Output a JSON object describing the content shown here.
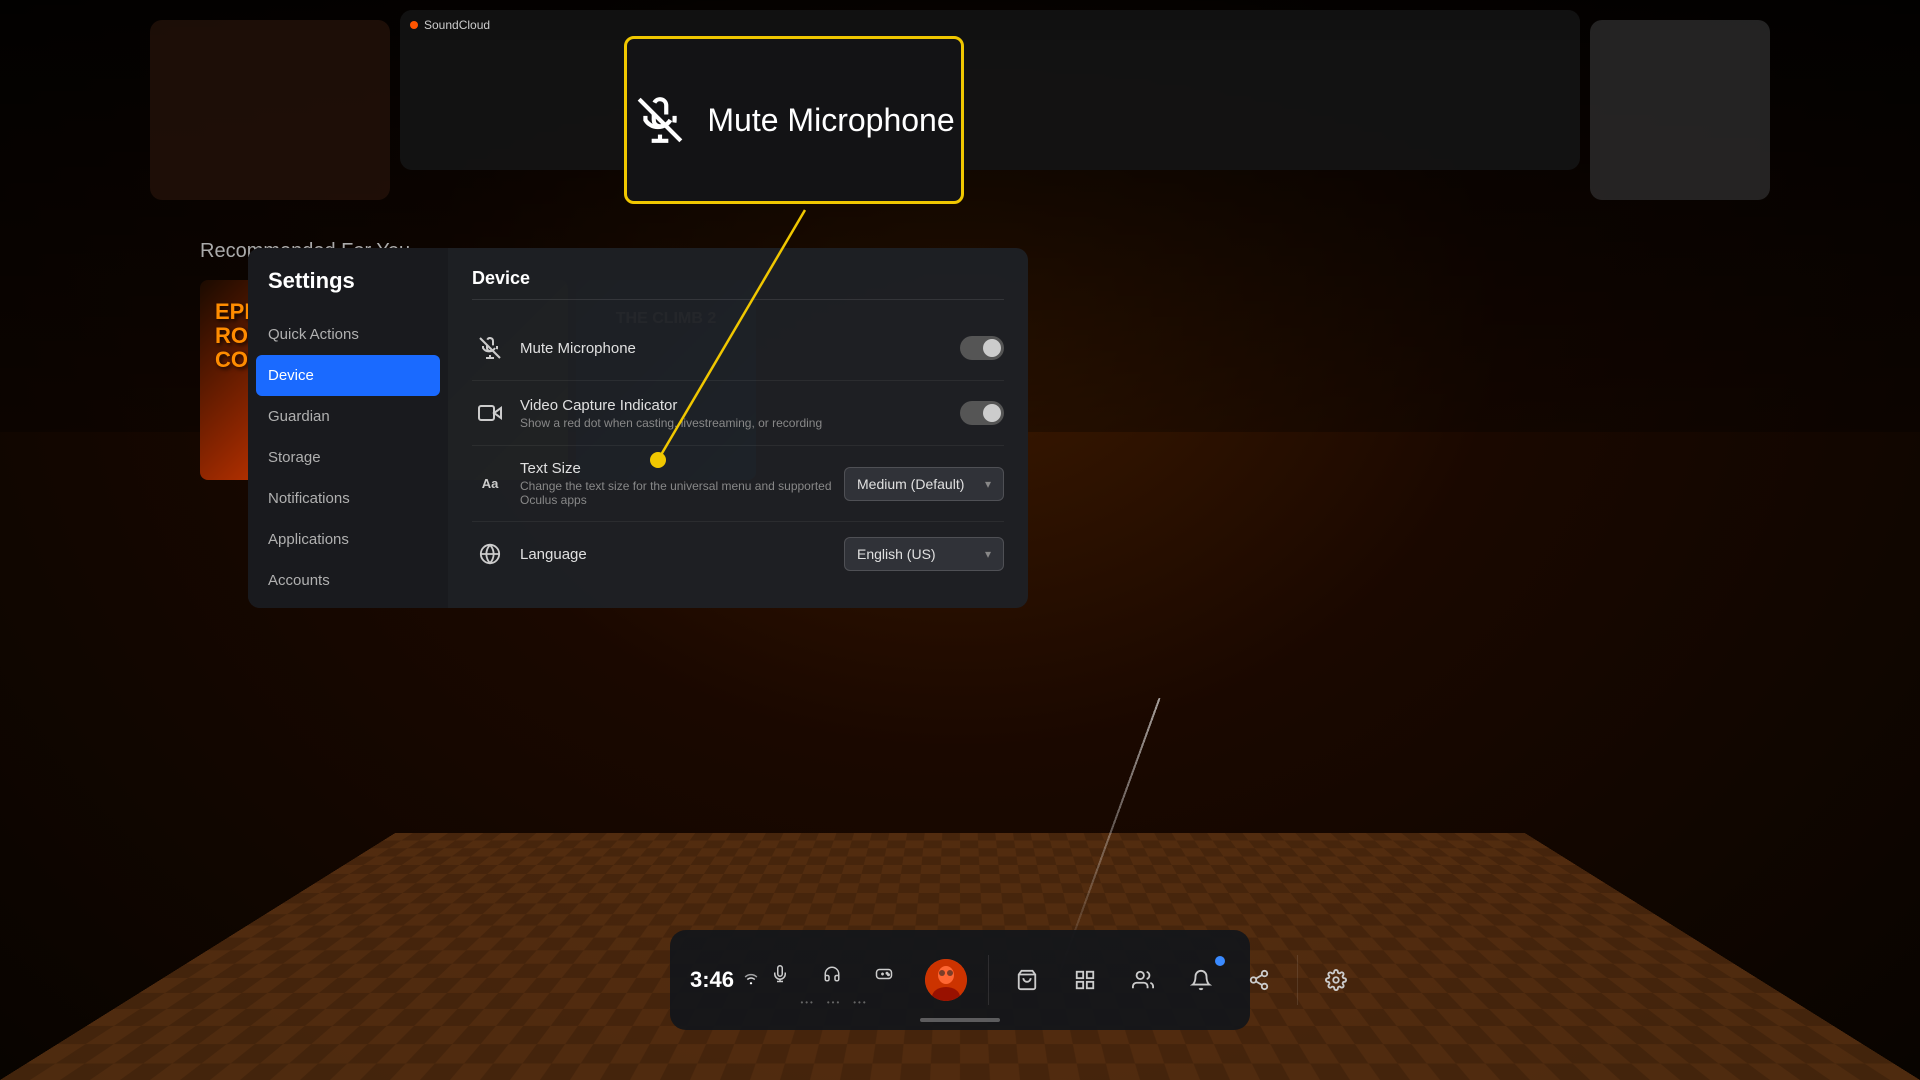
{
  "background": {
    "color": "#1a0a00"
  },
  "tooltip": {
    "label": "Mute Microphone",
    "border_color": "#f0c700"
  },
  "settings": {
    "title": "Settings",
    "sidebar": {
      "items": [
        {
          "id": "quick-actions",
          "label": "Quick Actions",
          "active": false
        },
        {
          "id": "device",
          "label": "Device",
          "active": true
        },
        {
          "id": "guardian",
          "label": "Guardian",
          "active": false
        },
        {
          "id": "storage",
          "label": "Storage",
          "active": false
        },
        {
          "id": "notifications",
          "label": "Notifications",
          "active": false
        },
        {
          "id": "applications",
          "label": "Applications",
          "active": false
        },
        {
          "id": "accounts",
          "label": "Accounts",
          "active": false
        }
      ]
    },
    "content": {
      "section_title": "Device",
      "items": [
        {
          "id": "mute-microphone",
          "icon": "🎤",
          "name": "Mute Microphone",
          "desc": "",
          "control": "toggle",
          "toggle_state": false
        },
        {
          "id": "video-capture-indicator",
          "icon": "📹",
          "name": "Video Capture Indicator",
          "desc": "Show a red dot when casting, livestreaming, or recording",
          "control": "toggle",
          "toggle_state": false
        },
        {
          "id": "text-size",
          "icon": "Aa",
          "name": "Text Size",
          "desc": "Change the text size for the universal menu and supported Oculus apps",
          "control": "dropdown",
          "dropdown_value": "Medium (Default)"
        },
        {
          "id": "language",
          "icon": "🌐",
          "name": "Language",
          "desc": "",
          "control": "dropdown",
          "dropdown_value": "English (US)"
        }
      ]
    }
  },
  "recommended": {
    "title": "Recommended For You"
  },
  "games": [
    {
      "id": "epic-roller",
      "title": "EPIC\nROLLER\nCOASTERS",
      "style": "epic"
    },
    {
      "id": "the-climb",
      "title": "THE CLIMB 2",
      "style": "climb"
    }
  ],
  "taskbar": {
    "time": "3:46",
    "icons": [
      {
        "id": "mic-settings",
        "symbol": "⊕",
        "badge": false
      },
      {
        "id": "vr-headset",
        "symbol": "⊙",
        "badge": false
      },
      {
        "id": "headphones",
        "symbol": "◎",
        "badge": false
      },
      {
        "id": "avatar",
        "symbol": "avatar",
        "badge": false
      },
      {
        "id": "store",
        "symbol": "🛍",
        "badge": false
      },
      {
        "id": "apps",
        "symbol": "⊞",
        "badge": false
      },
      {
        "id": "people",
        "symbol": "👥",
        "badge": false
      },
      {
        "id": "notifications",
        "symbol": "🔔",
        "badge": true
      },
      {
        "id": "share",
        "symbol": "↗",
        "badge": false
      },
      {
        "id": "settings-gear",
        "symbol": "⚙",
        "badge": false
      }
    ]
  }
}
